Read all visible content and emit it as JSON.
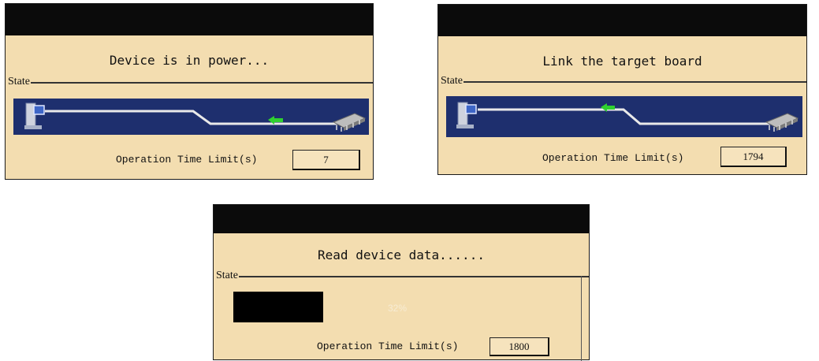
{
  "dialogs": [
    {
      "message": "Device is in power...",
      "group_label": "State",
      "limit_label": "Operation Time Limit(s)",
      "limit_value": "7"
    },
    {
      "message": "Link the target board",
      "group_label": "State",
      "limit_label": "Operation Time Limit(s)",
      "limit_value": "1794"
    },
    {
      "message": "Read device data......",
      "group_label": "State",
      "progress_percent_text": "32%",
      "progress_fraction": 0.33,
      "limit_label": "Operation Time Limit(s)",
      "limit_value": "1800"
    }
  ],
  "colors": {
    "dialog_bg": "#f3ddb0",
    "title_bar": "#0b0b0b",
    "state_band": "#1e2f6e",
    "link_line": "#e9e9e9",
    "arrow": "#2fd12f"
  }
}
